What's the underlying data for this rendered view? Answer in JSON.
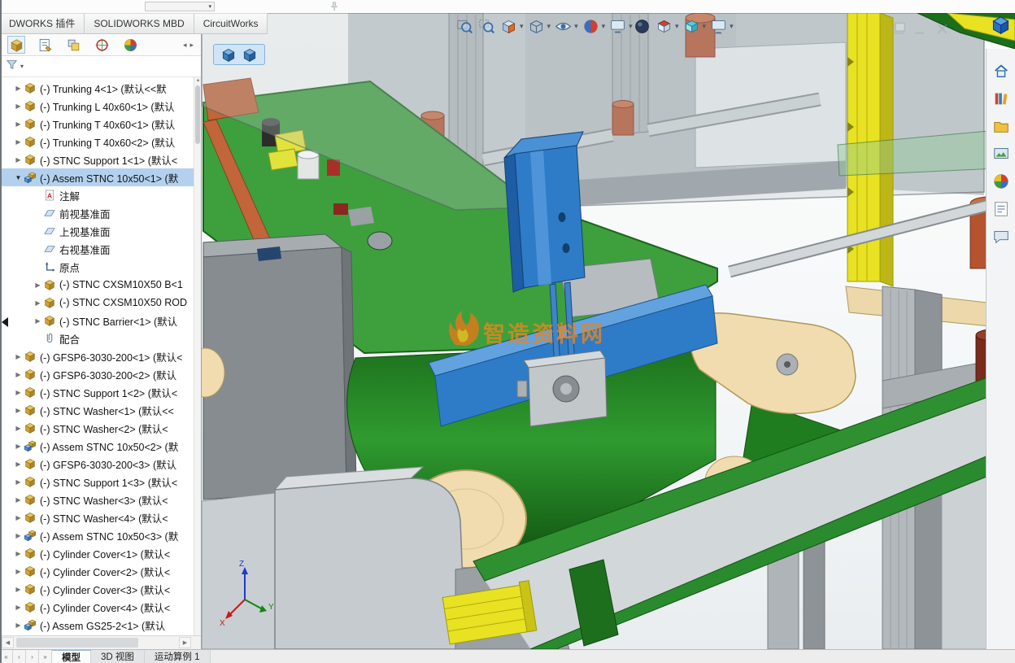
{
  "colors": {
    "accent-blue": "#2e7cc8",
    "selection-bg": "#b3d1ef",
    "deck-green": "#3da03d",
    "rail-green": "#2f9032",
    "yellow": "#e8e222",
    "tan": "#f0dcae",
    "copper": "#b5532f",
    "watermark-orange": "#e8861c"
  },
  "titlebar": {
    "items": [
      {
        "name": "quick-access-dropdown"
      },
      {
        "name": "pin"
      }
    ]
  },
  "ribbon": {
    "tabs": [
      "DWORKS 插件",
      "SOLIDWORKS MBD",
      "CircuitWorks"
    ]
  },
  "panel": {
    "tabs": [
      {
        "name": "feature-tree",
        "active": true
      },
      {
        "name": "property-manager"
      },
      {
        "name": "configuration-manager"
      },
      {
        "name": "dimxpert"
      },
      {
        "name": "display-manager"
      }
    ],
    "filter": {
      "icon": "funnel"
    }
  },
  "tree": {
    "items": [
      {
        "label": "(-) Trunking 4<1> (默认<<默",
        "level": 0,
        "arrow": "collapsed",
        "icon": "part"
      },
      {
        "label": "(-) Trunking L 40x60<1> (默认",
        "level": 0,
        "arrow": "collapsed",
        "icon": "part"
      },
      {
        "label": "(-) Trunking T 40x60<1> (默认",
        "level": 0,
        "arrow": "collapsed",
        "icon": "part"
      },
      {
        "label": "(-) Trunking T 40x60<2> (默认",
        "level": 0,
        "arrow": "collapsed",
        "icon": "part"
      },
      {
        "label": "(-) STNC Support 1<1> (默认<",
        "level": 0,
        "arrow": "collapsed",
        "icon": "part"
      },
      {
        "label": "(-) Assem STNC 10x50<1> (默",
        "level": 0,
        "arrow": "expanded",
        "icon": "assembly",
        "selected": true
      },
      {
        "label": "注解",
        "level": 1,
        "arrow": null,
        "icon": "annotation"
      },
      {
        "label": "前视基准面",
        "level": 1,
        "arrow": null,
        "icon": "plane"
      },
      {
        "label": "上视基准面",
        "level": 1,
        "arrow": null,
        "icon": "plane"
      },
      {
        "label": "右视基准面",
        "level": 1,
        "arrow": null,
        "icon": "plane"
      },
      {
        "label": "原点",
        "level": 1,
        "arrow": null,
        "icon": "origin"
      },
      {
        "label": "(-) STNC CXSM10X50 B<1",
        "level": 1,
        "arrow": "collapsed",
        "icon": "part"
      },
      {
        "label": "(-) STNC CXSM10X50 ROD",
        "level": 1,
        "arrow": "collapsed",
        "icon": "part"
      },
      {
        "label": "(-) STNC Barrier<1> (默认",
        "level": 1,
        "arrow": "collapsed",
        "icon": "part"
      },
      {
        "label": "配合",
        "level": 1,
        "arrow": null,
        "icon": "mates"
      },
      {
        "label": "(-) GFSP6-3030-200<1> (默认<",
        "level": 0,
        "arrow": "collapsed",
        "icon": "part"
      },
      {
        "label": "(-) GFSP6-3030-200<2> (默认",
        "level": 0,
        "arrow": "collapsed",
        "icon": "part"
      },
      {
        "label": "(-) STNC Support 1<2> (默认<",
        "level": 0,
        "arrow": "collapsed",
        "icon": "part"
      },
      {
        "label": "(-) STNC Washer<1> (默认<<",
        "level": 0,
        "arrow": "collapsed",
        "icon": "part"
      },
      {
        "label": "(-) STNC Washer<2> (默认<",
        "level": 0,
        "arrow": "collapsed",
        "icon": "part"
      },
      {
        "label": "(-) Assem STNC 10x50<2> (默",
        "level": 0,
        "arrow": "collapsed",
        "icon": "assembly"
      },
      {
        "label": "(-) GFSP6-3030-200<3> (默认",
        "level": 0,
        "arrow": "collapsed",
        "icon": "part"
      },
      {
        "label": "(-) STNC Support 1<3> (默认<",
        "level": 0,
        "arrow": "collapsed",
        "icon": "part"
      },
      {
        "label": "(-) STNC Washer<3> (默认<",
        "level": 0,
        "arrow": "collapsed",
        "icon": "part"
      },
      {
        "label": "(-) STNC Washer<4> (默认<",
        "level": 0,
        "arrow": "collapsed",
        "icon": "part"
      },
      {
        "label": "(-) Assem STNC 10x50<3> (默",
        "level": 0,
        "arrow": "collapsed",
        "icon": "assembly"
      },
      {
        "label": "(-) Cylinder Cover<1> (默认<",
        "level": 0,
        "arrow": "collapsed",
        "icon": "part"
      },
      {
        "label": "(-) Cylinder Cover<2> (默认<",
        "level": 0,
        "arrow": "collapsed",
        "icon": "part"
      },
      {
        "label": "(-) Cylinder Cover<3> (默认<",
        "level": 0,
        "arrow": "collapsed",
        "icon": "part"
      },
      {
        "label": "(-) Cylinder Cover<4> (默认<",
        "level": 0,
        "arrow": "collapsed",
        "icon": "part"
      },
      {
        "label": "(-) Assem GS25-2<1> (默认",
        "level": 0,
        "arrow": "collapsed",
        "icon": "assembly"
      }
    ]
  },
  "viewport": {
    "doc_tabs": [
      {
        "name": "assembly-doc-1"
      },
      {
        "name": "assembly-doc-2"
      }
    ],
    "heads_up_icons": [
      {
        "name": "zoom-fit"
      },
      {
        "name": "zoom-area"
      },
      {
        "name": "section-view",
        "dropdown": true
      },
      {
        "name": "display-style",
        "dropdown": true
      },
      {
        "name": "hide-show-items",
        "dropdown": true
      },
      {
        "name": "edit-appearance",
        "dropdown": true
      },
      {
        "name": "view-settings",
        "dropdown": true
      }
    ],
    "view_icons": [
      {
        "name": "apply-scene"
      },
      {
        "name": "view-orientation",
        "dropdown": true
      },
      {
        "name": "standard-views",
        "dropdown": true
      },
      {
        "name": "fullscreen",
        "dropdown": true
      }
    ],
    "window_icons": [
      {
        "name": "float-window"
      },
      {
        "name": "minimize-window"
      },
      {
        "name": "close-window"
      }
    ],
    "watermark": {
      "text": "智造资料网"
    },
    "triad": {
      "x": "X",
      "y": "Y",
      "z": "Z"
    }
  },
  "task_pane": {
    "icons": [
      {
        "name": "home"
      },
      {
        "name": "design-library"
      },
      {
        "name": "file-explorer"
      },
      {
        "name": "view-palette"
      },
      {
        "name": "appearances-scenes"
      },
      {
        "name": "custom-properties"
      },
      {
        "name": "forum"
      }
    ]
  },
  "status_bar": {
    "scroll_buttons": [
      {
        "name": "first"
      },
      {
        "name": "prev"
      },
      {
        "name": "next"
      },
      {
        "name": "last"
      }
    ],
    "tabs": [
      {
        "label": "模型",
        "active": true
      },
      {
        "label": "3D 视图",
        "active": false
      },
      {
        "label": "运动算例 1",
        "active": false
      }
    ]
  }
}
